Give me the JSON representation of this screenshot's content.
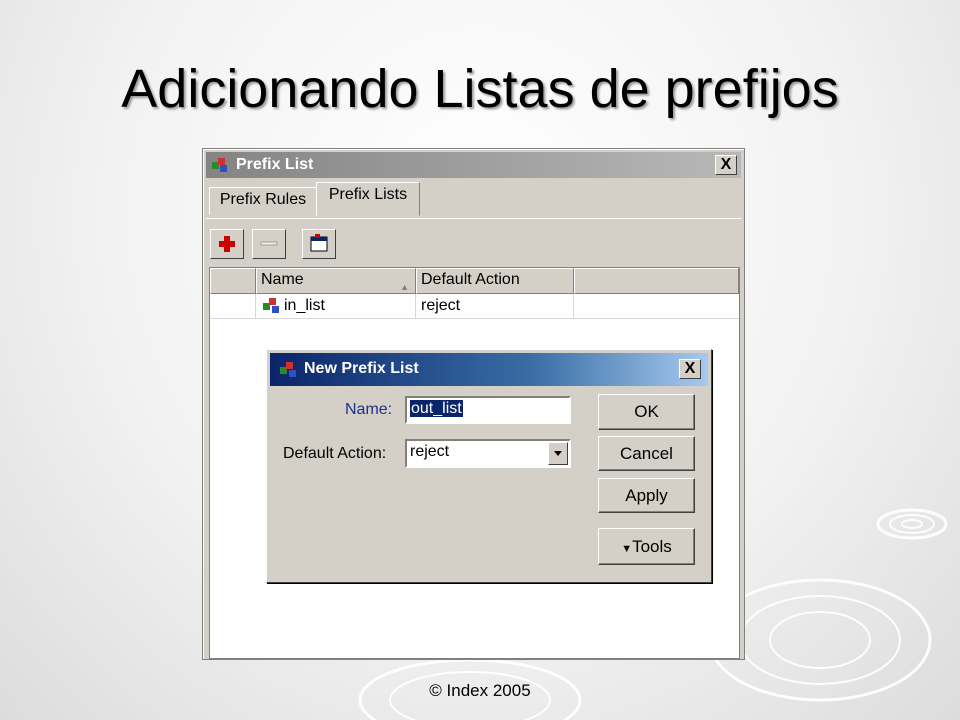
{
  "slide": {
    "title": "Adicionando Listas de prefijos",
    "footer": "© Index 2005"
  },
  "prefix_window": {
    "title": "Prefix List",
    "close_label": "X",
    "tabs": [
      {
        "label": "Prefix Rules",
        "active": false
      },
      {
        "label": "Prefix Lists",
        "active": true
      }
    ],
    "toolbar": [
      {
        "name": "add",
        "icon": "plus-icon"
      },
      {
        "name": "remove",
        "icon": "minus-icon"
      },
      {
        "name": "open",
        "icon": "window-icon"
      }
    ],
    "columns": [
      "Name",
      "Default Action"
    ],
    "rows": [
      {
        "name": "in_list",
        "default_action": "reject",
        "icon": "prefix-list-icon"
      }
    ]
  },
  "new_prefix_dialog": {
    "title": "New Prefix List",
    "close_label": "X",
    "name_label": "Name:",
    "name_value": "out_list",
    "action_label": "Default Action:",
    "action_value": "reject",
    "buttons": {
      "ok": "OK",
      "cancel": "Cancel",
      "apply": "Apply",
      "tools": "Tools"
    }
  },
  "colors": {
    "dialog_title_start": "#0a246a",
    "dialog_title_end": "#a6caf0",
    "window_title_inactive": "#848484",
    "dialog_face": "#d4d0c8",
    "add_icon": "#cc0000"
  }
}
